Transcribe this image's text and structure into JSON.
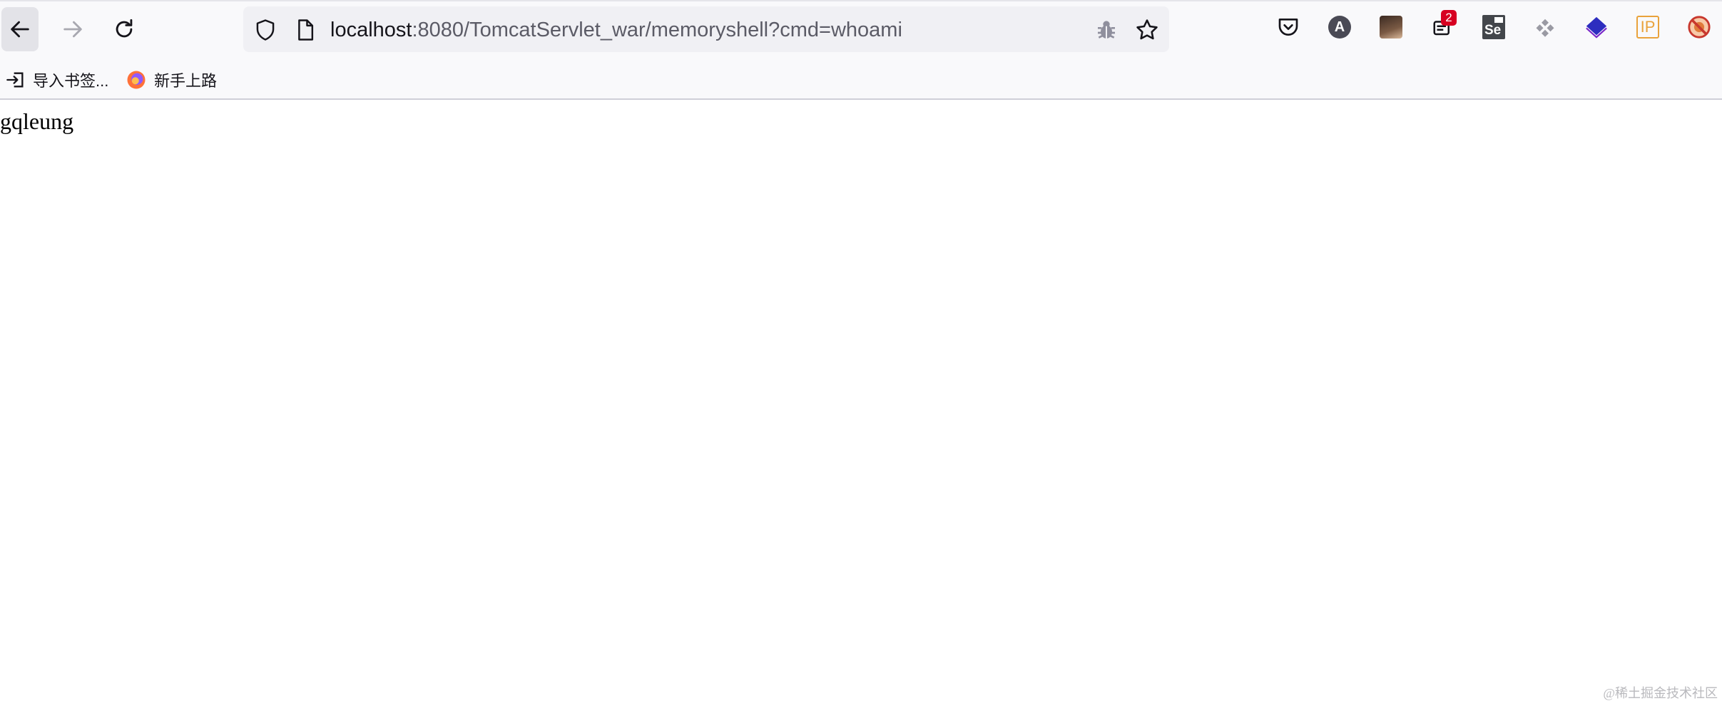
{
  "browser": {
    "url_host": "localhost",
    "url_rest": ":8080/TomcatServlet_war/memoryshell?cmd=whoami",
    "extensions": [
      {
        "name": "pocket-icon"
      },
      {
        "name": "account-a-icon",
        "label": "A"
      },
      {
        "name": "avatar-extension-icon"
      },
      {
        "name": "badge-extension-icon",
        "badge": "2"
      },
      {
        "name": "selenium-icon",
        "label": "Se"
      },
      {
        "name": "puzzle-extension-icon"
      },
      {
        "name": "layers-extension-icon"
      },
      {
        "name": "ip-extension-icon",
        "label": "IP"
      },
      {
        "name": "blocker-extension-icon"
      }
    ]
  },
  "bookmarks": [
    {
      "label": "导入书签..."
    },
    {
      "label": "新手上路"
    }
  ],
  "page": {
    "text": "gqleung"
  },
  "watermark": "@稀土掘金技术社区",
  "colors": {
    "toolbar_bg": "#f9f9fb",
    "urlbar_bg": "#f0f0f4",
    "badge": "#d70022",
    "selenium": "#43464b",
    "layers": "#2d2dbf",
    "ip": "#e9a23b"
  }
}
